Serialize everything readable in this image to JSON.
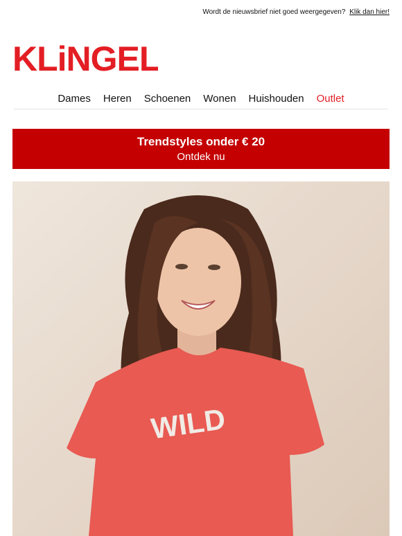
{
  "preheader": {
    "text": "Wordt de nieuwsbrief niet goed weergegeven?",
    "link": "Klik dan hier!"
  },
  "brand": {
    "name": "KLiNGEL",
    "color": "#e31e24"
  },
  "nav": {
    "items": [
      "Dames",
      "Heren",
      "Schoenen",
      "Wonen",
      "Huishouden"
    ],
    "outlet": "Outlet",
    "outlet_color": "#e31e24"
  },
  "banner": {
    "title": "Trendstyles onder € 20",
    "cta": "Ontdek nu",
    "background": "#c40000"
  },
  "hero": {
    "shirt_text": "WILD",
    "shirt_color": "#e85a52"
  }
}
